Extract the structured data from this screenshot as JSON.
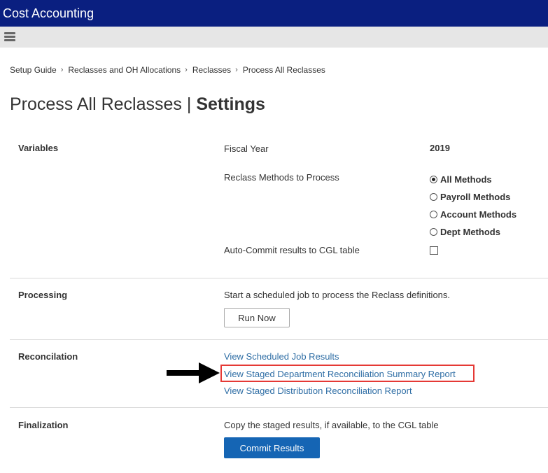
{
  "app": {
    "title": "Cost Accounting"
  },
  "breadcrumb": [
    "Setup Guide",
    "Reclasses and OH Allocations",
    "Reclasses",
    "Process All Reclasses"
  ],
  "page": {
    "title_main": "Process All Reclasses | ",
    "title_strong": "Settings"
  },
  "variables": {
    "section_label": "Variables",
    "fiscal_year_label": "Fiscal Year",
    "fiscal_year_value": "2019",
    "methods_label": "Reclass Methods to Process",
    "methods": [
      {
        "label": "All Methods",
        "checked": true
      },
      {
        "label": "Payroll Methods",
        "checked": false
      },
      {
        "label": "Account Methods",
        "checked": false
      },
      {
        "label": "Dept Methods",
        "checked": false
      }
    ],
    "auto_commit_label": "Auto-Commit results to CGL table",
    "auto_commit_checked": false
  },
  "processing": {
    "section_label": "Processing",
    "description": "Start a scheduled job to process the Reclass definitions.",
    "button_label": "Run Now"
  },
  "reconciliation": {
    "section_label": "Reconcilation",
    "links": [
      "View Scheduled Job Results",
      "View Staged Department Reconciliation Summary Report",
      "View Staged Distribution Reconciliation Report"
    ]
  },
  "finalization": {
    "section_label": "Finalization",
    "description": "Copy the staged results, if available, to the CGL table",
    "button_label": "Commit Results"
  },
  "colors": {
    "header_bg": "#0a1f80",
    "menubar_bg": "#e6e6e6",
    "link": "#2f6ea5",
    "primary_button": "#1565b4",
    "highlight": "#e53935"
  }
}
